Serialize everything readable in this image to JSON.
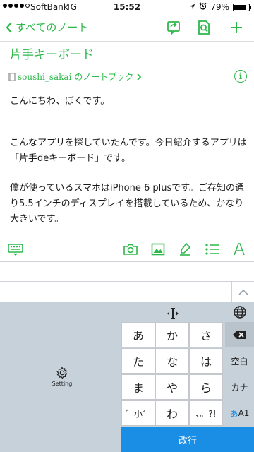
{
  "status": {
    "carrier": "SoftBank",
    "network": "4G",
    "time": "15:52",
    "battery": "79%",
    "battery_level": 0.79
  },
  "nav": {
    "back_label": "すべてのノート",
    "accent": "#2db84b"
  },
  "note": {
    "title": "片手キーボード",
    "notebook": "soushi_sakai のノートブック",
    "paragraphs": [
      "こんにちわ、ぼくです。",
      "こんなアプリを探していたんです。今日紹介するアプリは「片手deキーボード」です。",
      "僕が使っているスマホはiPhone 6 plusです。ご存知の通り5.5インチのディスプレイを搭載しているため、かなり大きいです。"
    ]
  },
  "toolbar_icons": [
    "keyboard-icon",
    "camera-icon",
    "image-icon",
    "marker-icon",
    "list-icon",
    "font-icon"
  ],
  "keyboard": {
    "setting_label": "Setting",
    "keys": [
      [
        "あ",
        "か",
        "さ"
      ],
      [
        "た",
        "な",
        "は"
      ],
      [
        "ま",
        "や",
        "ら"
      ],
      [
        "゛小゜",
        "わ",
        "、。?!"
      ]
    ],
    "side_keys": [
      "空白",
      "カナ"
    ],
    "aa_label": "あ",
    "aa_suffix": "A1",
    "return_label": "改行",
    "return_color": "#1a8de4"
  }
}
